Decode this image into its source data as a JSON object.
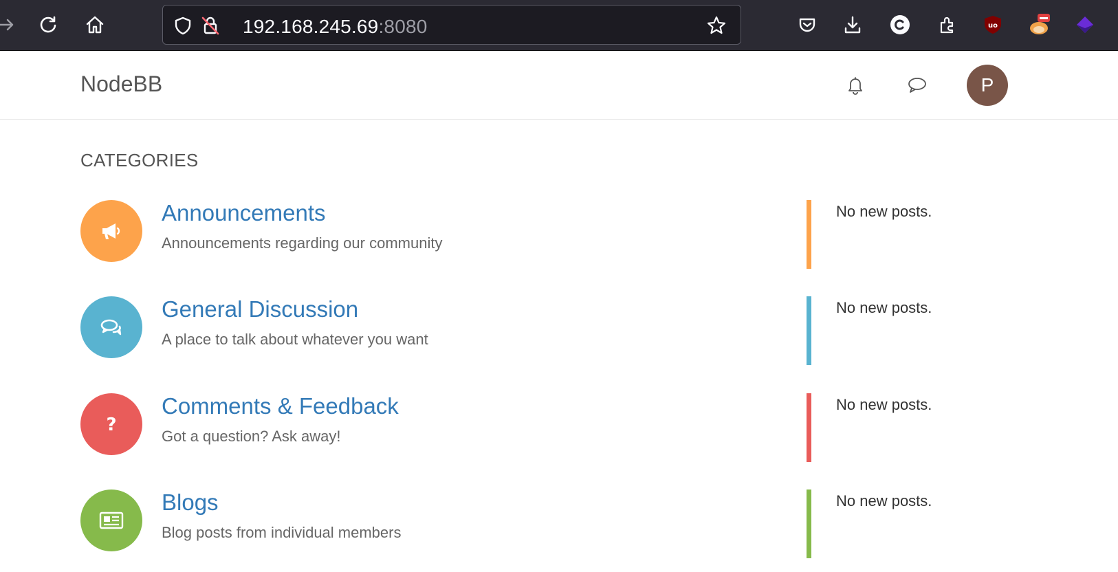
{
  "browser": {
    "url_host": "192.168.245.69",
    "url_port": ":8080",
    "icons": [
      "forward-icon",
      "reload-icon",
      "home-icon",
      "shield-icon",
      "insecure-lock-icon",
      "bookmark-star-icon",
      "pocket-icon",
      "download-icon",
      "c-extension-icon",
      "extensions-icon",
      "ublock-icon",
      "fox-extension-icon",
      "purple-extension-icon"
    ]
  },
  "header": {
    "brand": "NodeBB",
    "avatar_letter": "P",
    "avatar_color": "#795548",
    "icons": [
      "bell-icon",
      "chat-icon"
    ]
  },
  "categories": {
    "heading": "CATEGORIES",
    "items": [
      {
        "title": "Announcements",
        "description": "Announcements regarding our community",
        "latest": "No new posts.",
        "color": "#fda34b",
        "icon": "bullhorn-icon"
      },
      {
        "title": "General Discussion",
        "description": "A place to talk about whatever you want",
        "latest": "No new posts.",
        "color": "#59b3d0",
        "icon": "comments-icon"
      },
      {
        "title": "Comments & Feedback",
        "description": "Got a question? Ask away!",
        "latest": "No new posts.",
        "color": "#e95c5a",
        "icon": "question-icon"
      },
      {
        "title": "Blogs",
        "description": "Blog posts from individual members",
        "latest": "No new posts.",
        "color": "#86ba4b",
        "icon": "newspaper-icon"
      }
    ]
  }
}
